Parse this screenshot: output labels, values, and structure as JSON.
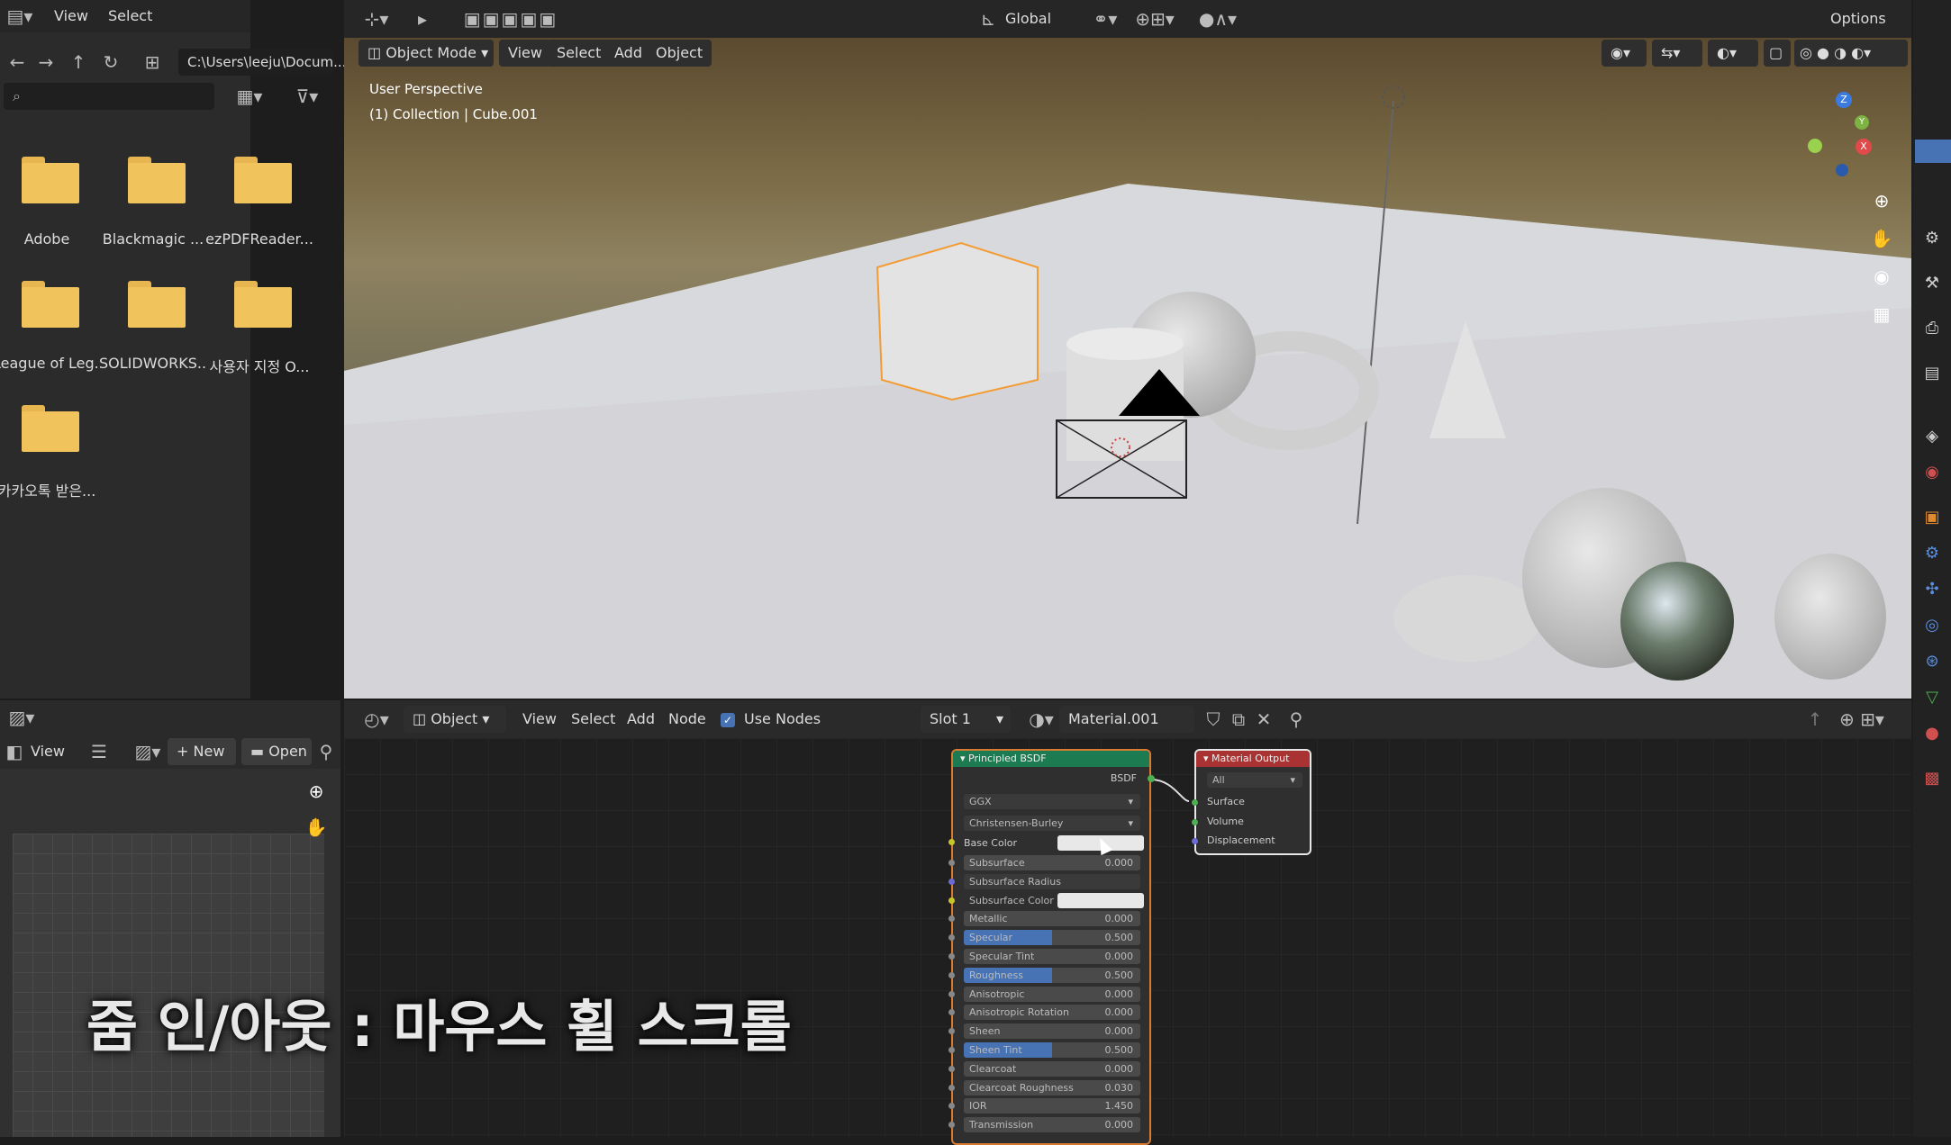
{
  "file_browser": {
    "menu": [
      "View",
      "Select"
    ],
    "path": "C:\\Users\\leeju\\Docum...",
    "items": [
      {
        "label": "Adobe"
      },
      {
        "label": "Blackmagic ..."
      },
      {
        "label": "ezPDFReader..."
      },
      {
        "label": "League of Leg..."
      },
      {
        "label": "SOLIDWORKS..."
      },
      {
        "label": "사용자 지정 O..."
      },
      {
        "label": "카카오톡 받은..."
      }
    ]
  },
  "viewport": {
    "header": {
      "transform": "Global",
      "options": "Options"
    },
    "toolbar": {
      "mode": "Object Mode",
      "menu": [
        "View",
        "Select",
        "Add",
        "Object"
      ]
    },
    "overlay_line1": "User Perspective",
    "overlay_line2": "(1) Collection | Cube.001",
    "gizmo": {
      "x": "X",
      "y": "Y",
      "z": "Z"
    }
  },
  "image_editor": {
    "view": "View",
    "new": "New",
    "open": "Open"
  },
  "node_editor": {
    "object": "Object",
    "menu": [
      "View",
      "Select",
      "Add",
      "Node"
    ],
    "use_nodes": "Use Nodes",
    "slot": "Slot 1",
    "material": "Material.001"
  },
  "principled": {
    "title": "Principled BSDF",
    "output": "BSDF",
    "dist": "GGX",
    "sss": "Christensen-Burley",
    "base_color": "Base Color",
    "rows": [
      {
        "label": "Subsurface",
        "value": "0.000"
      },
      {
        "label": "Subsurface Radius",
        "value": ""
      },
      {
        "label": "Subsurface Color",
        "value": ""
      },
      {
        "label": "Metallic",
        "value": "0.000"
      },
      {
        "label": "Specular",
        "value": "0.500"
      },
      {
        "label": "Specular Tint",
        "value": "0.000"
      },
      {
        "label": "Roughness",
        "value": "0.500"
      },
      {
        "label": "Anisotropic",
        "value": "0.000"
      },
      {
        "label": "Anisotropic Rotation",
        "value": "0.000"
      },
      {
        "label": "Sheen",
        "value": "0.000"
      },
      {
        "label": "Sheen Tint",
        "value": "0.500"
      },
      {
        "label": "Clearcoat",
        "value": "0.000"
      },
      {
        "label": "Clearcoat Roughness",
        "value": "0.030"
      },
      {
        "label": "IOR",
        "value": "1.450"
      },
      {
        "label": "Transmission",
        "value": "0.000"
      }
    ]
  },
  "material_output": {
    "title": "Material Output",
    "target": "All",
    "inputs": [
      "Surface",
      "Volume",
      "Displacement"
    ]
  },
  "caption": "줌 인/아웃 : 마우스 휠 스크롤"
}
